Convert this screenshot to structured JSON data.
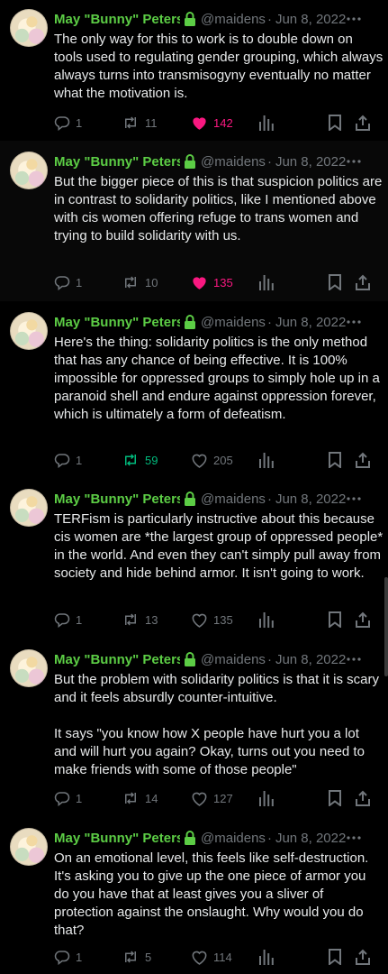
{
  "tweets": [
    {
      "author": "May \"Bunny\" Peters",
      "handle": "@maidens",
      "dot": "·",
      "date": "Jun 8, 2022",
      "text": "The only way for this to work is to double down on tools used to regulating gender grouping, which always always turns into transmisogyny eventually no matter what the motivation is.",
      "replies": "1",
      "retweets": "11",
      "likes": "142",
      "liked": true,
      "retweeted": false
    },
    {
      "author": "May \"Bunny\" Peters",
      "handle": "@maidens",
      "dot": "·",
      "date": "Jun 8, 2022",
      "text": "But the bigger piece of this is that suspicion politics are in contrast to solidarity politics, like I mentioned above with cis women offering refuge to trans women and trying to build solidarity with us.",
      "replies": "1",
      "retweets": "10",
      "likes": "135",
      "liked": true,
      "retweeted": false
    },
    {
      "author": "May \"Bunny\" Peters",
      "handle": "@maidens",
      "dot": "·",
      "date": "Jun 8, 2022",
      "text": "Here's the thing: solidarity politics is the only method that has any chance of being effective. It is 100% impossible for oppressed groups to simply hole up in a paranoid shell and endure against oppression forever, which is ultimately a form of defeatism.",
      "replies": "1",
      "retweets": "59",
      "likes": "205",
      "liked": false,
      "retweeted": true
    },
    {
      "author": "May \"Bunny\" Peters",
      "handle": "@maidens",
      "dot": "·",
      "date": "Jun 8, 2022",
      "text": "TERFism is particularly instructive about this because cis women are *the largest group of oppressed people* in the world. And even they can't simply pull away from society and hide behind armor. It isn't going to work.",
      "replies": "1",
      "retweets": "13",
      "likes": "135",
      "liked": false,
      "retweeted": false
    },
    {
      "author": "May \"Bunny\" Peters",
      "handle": "@maidens",
      "dot": "·",
      "date": "Jun 8, 2022",
      "text": "But the problem with solidarity politics is that it is scary and it feels absurdly counter-intuitive.\n\nIt says \"you know how X people have hurt you a lot and will hurt you again? Okay, turns out you need to make friends with some of those people\"",
      "replies": "1",
      "retweets": "14",
      "likes": "127",
      "liked": false,
      "retweeted": false
    },
    {
      "author": "May \"Bunny\" Peters",
      "handle": "@maidens",
      "dot": "·",
      "date": "Jun 8, 2022",
      "text": "On an emotional level, this feels like self-destruction. It's asking you to give up the one piece of armor you do you have that at least gives you a sliver of protection against the onslaught. Why would you do that?",
      "replies": "1",
      "retweets": "5",
      "likes": "114",
      "liked": false,
      "retweeted": false
    }
  ],
  "colors": {
    "name": "#5ccd45",
    "muted": "#71767b",
    "like_active": "#f91880",
    "retweet_active": "#00ba7c",
    "background": "#000000"
  },
  "icons": [
    "lock-icon",
    "more-icon",
    "reply-icon",
    "retweet-icon",
    "like-icon",
    "views-icon",
    "bookmark-icon",
    "share-icon"
  ]
}
